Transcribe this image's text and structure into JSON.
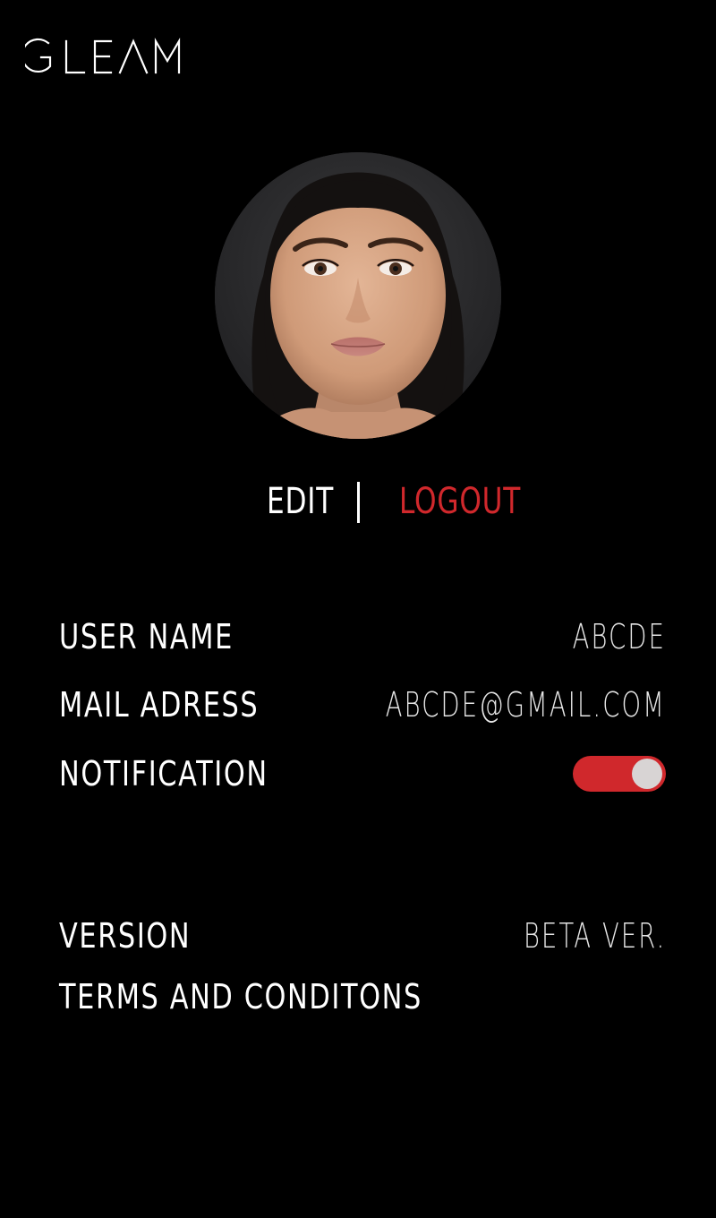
{
  "app": {
    "logo_text": "GLEAM"
  },
  "profile_actions": {
    "edit_label": "EDIT",
    "logout_label": "LOGOUT"
  },
  "account": {
    "username_label": "USER NAME",
    "username_value": "ABCDE",
    "email_label": "MAIL ADRESS",
    "email_value": "ABCDE@GMAIL.COM",
    "notification_label": "NOTIFICATION",
    "notification_enabled": true
  },
  "about": {
    "version_label": "VERSION",
    "version_value": "BETA VER.",
    "terms_label": "TERMS AND CONDITONS"
  },
  "colors": {
    "background": "#000000",
    "text": "#ffffff",
    "accent": "#d0282c",
    "toggle_knob": "#d8d4d4"
  }
}
